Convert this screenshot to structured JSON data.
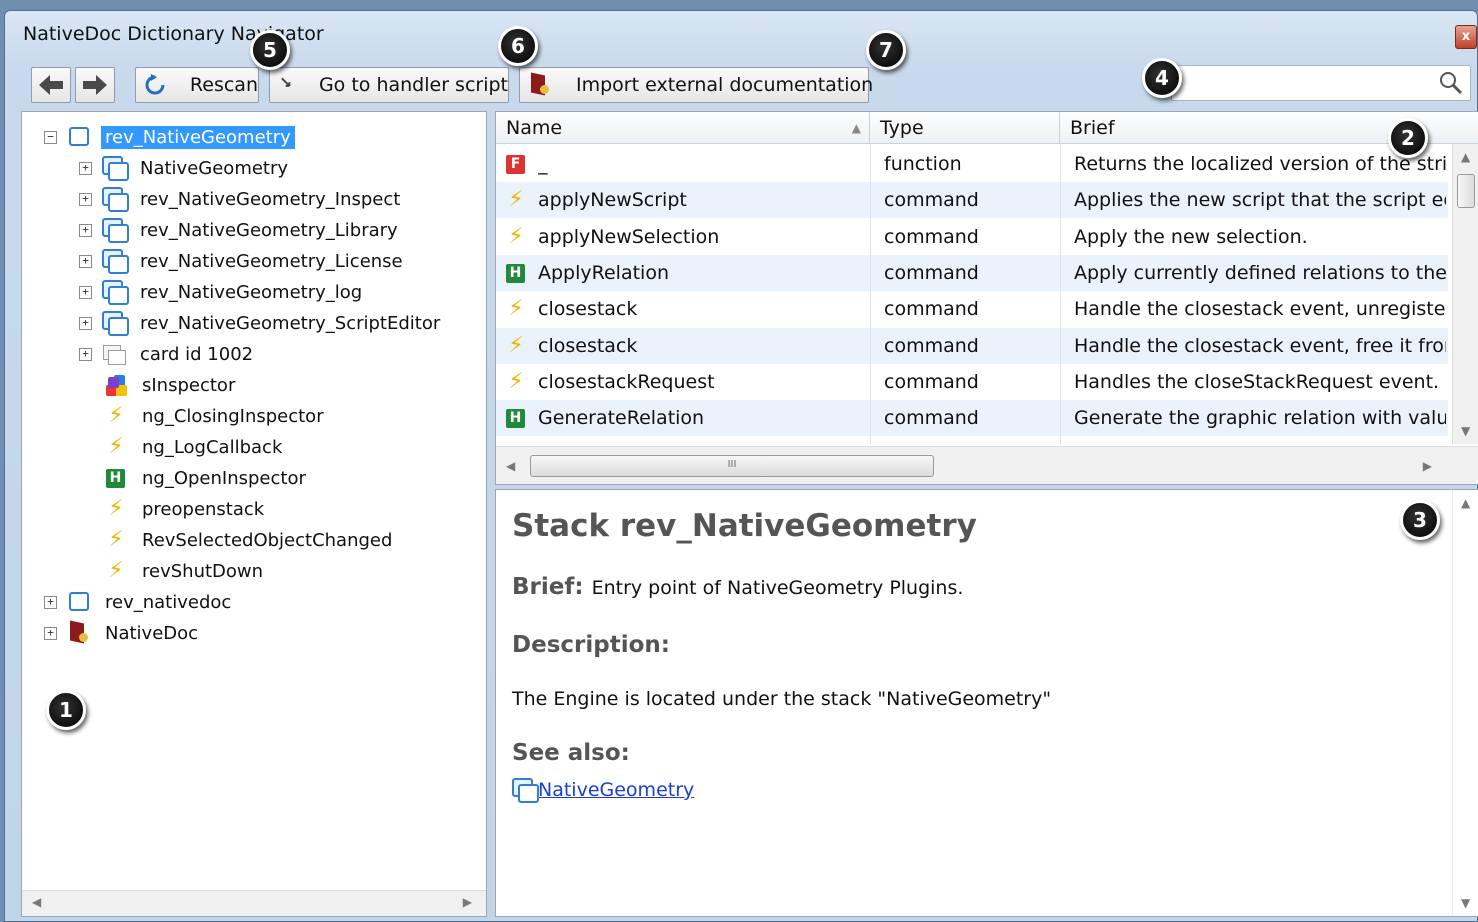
{
  "window": {
    "title": "NativeDoc Dictionary Navigator",
    "close_glyph": "x"
  },
  "toolbar": {
    "back_icon": "back-arrow-icon",
    "forward_icon": "forward-arrow-icon",
    "rescan_label": "Rescan",
    "goto_label": "Go to handler script",
    "import_label": "Import external documentation",
    "search_placeholder": "",
    "search_value": ""
  },
  "tree": {
    "items": [
      {
        "label": "rev_NativeGeometry",
        "icon": "stack-icon",
        "expander": "−",
        "selected": true
      },
      {
        "label": "NativeGeometry",
        "icon": "substack-icon",
        "expander": "+"
      },
      {
        "label": "rev_NativeGeometry_Inspect",
        "icon": "substack-icon",
        "expander": "+"
      },
      {
        "label": "rev_NativeGeometry_Library",
        "icon": "substack-icon",
        "expander": "+"
      },
      {
        "label": "rev_NativeGeometry_License",
        "icon": "substack-icon",
        "expander": "+"
      },
      {
        "label": "rev_NativeGeometry_log",
        "icon": "substack-icon",
        "expander": "+"
      },
      {
        "label": "rev_NativeGeometry_ScriptEditor",
        "icon": "substack-icon",
        "expander": "+"
      },
      {
        "label": "card id 1002",
        "icon": "card-icon",
        "expander": "+"
      },
      {
        "label": "sInspector",
        "icon": "palette-icon"
      },
      {
        "label": "ng_ClosingInspector",
        "icon": "lightning-icon"
      },
      {
        "label": "ng_LogCallback",
        "icon": "lightning-icon"
      },
      {
        "label": "ng_OpenInspector",
        "icon": "handler-h-icon"
      },
      {
        "label": "preopenstack",
        "icon": "lightning-icon"
      },
      {
        "label": "RevSelectedObjectChanged",
        "icon": "lightning-icon"
      },
      {
        "label": "revShutDown",
        "icon": "lightning-icon"
      },
      {
        "label": "rev_nativedoc",
        "icon": "stack-icon",
        "expander": "+"
      },
      {
        "label": "NativeDoc",
        "icon": "book-icon",
        "expander": "+"
      }
    ]
  },
  "table": {
    "headers": {
      "name": "Name",
      "type": "Type",
      "brief": "Brief"
    },
    "rows": [
      {
        "icon": "function-f-icon",
        "name": "_",
        "type": "function",
        "brief": "Returns the localized version of the string"
      },
      {
        "icon": "lightning-icon",
        "name": "applyNewScript",
        "type": "command",
        "brief": "Applies the new script that the script editor"
      },
      {
        "icon": "lightning-icon",
        "name": "applyNewSelection",
        "type": "command",
        "brief": "Apply the new selection."
      },
      {
        "icon": "handler-h-icon",
        "name": "ApplyRelation",
        "type": "command",
        "brief": "Apply currently defined relations to the o"
      },
      {
        "icon": "lightning-icon",
        "name": "closestack",
        "type": "command",
        "brief": "Handle the closestack event, unregister th"
      },
      {
        "icon": "lightning-icon",
        "name": "closestack",
        "type": "command",
        "brief": "Handle the closestack event, free it from"
      },
      {
        "icon": "lightning-icon",
        "name": "closestackRequest",
        "type": "command",
        "brief": "Handles the closeStackRequest event. If p"
      },
      {
        "icon": "handler-h-icon",
        "name": "GenerateRelation",
        "type": "command",
        "brief": "Generate the graphic relation with values"
      }
    ],
    "hscroll_grip": "III"
  },
  "doc": {
    "title": "Stack rev_NativeGeometry",
    "brief_label": "Brief:",
    "brief_text": "Entry point of NativeGeometry Plugins.",
    "description_label": "Description:",
    "description_text": "The Engine is located under the stack \"NativeGeometry\"",
    "see_also_label": "See also:",
    "see_also_link": "NativeGeometry"
  },
  "callouts": [
    "1",
    "2",
    "3",
    "4",
    "5",
    "6",
    "7"
  ],
  "colors": {
    "selection": "#3399ff",
    "row_alt": "#eaf2fb",
    "link": "#1a3fd1",
    "lightning": "#f0b400",
    "handler": "#1f8a3a",
    "function": "#dd3333"
  }
}
